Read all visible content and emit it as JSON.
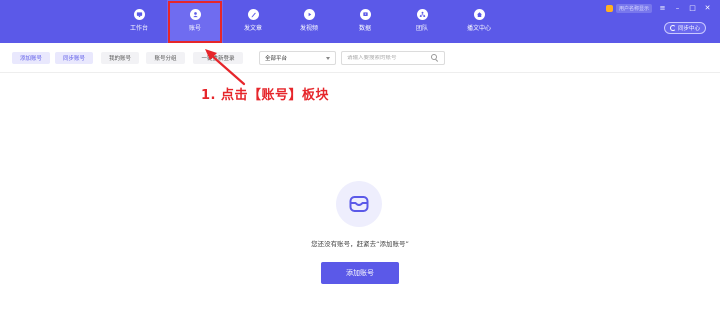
{
  "colors": {
    "brand": "#5b59e8",
    "brand_active": "#6f6cf0",
    "annotation_red": "#e6262b",
    "button_tint": "#e9e8fd"
  },
  "window": {
    "account_name": "用户名称显示",
    "menu_icon": "hamburger-icon",
    "minimize_icon": "minimize-icon",
    "maximize_icon": "maximize-icon",
    "close_icon": "close-icon"
  },
  "nav": {
    "items": [
      {
        "label": "工作台",
        "icon": "monitor-icon"
      },
      {
        "label": "账号",
        "icon": "user-icon",
        "active": true
      },
      {
        "label": "发文章",
        "icon": "pen-icon"
      },
      {
        "label": "发视频",
        "icon": "play-icon"
      },
      {
        "label": "数据",
        "icon": "chart-icon"
      },
      {
        "label": "团队",
        "icon": "team-icon"
      },
      {
        "label": "播文中心",
        "icon": "home-icon"
      }
    ],
    "sync_center_label": "同步中心"
  },
  "toolbar": {
    "add_account": "添加账号",
    "sync_account": "同步账号",
    "my_accounts": "我的账号",
    "account_groups": "账号分组",
    "one_click_login": "一键重新登录",
    "platform_select_value": "全部平台",
    "search_placeholder": "请输入要搜索的账号"
  },
  "annotation": {
    "text": "1. 点击【账号】板块"
  },
  "empty_state": {
    "icon": "inbox-icon",
    "message": "您还没有账号，赶紧去“添加账号”",
    "button_label": "添加账号"
  }
}
